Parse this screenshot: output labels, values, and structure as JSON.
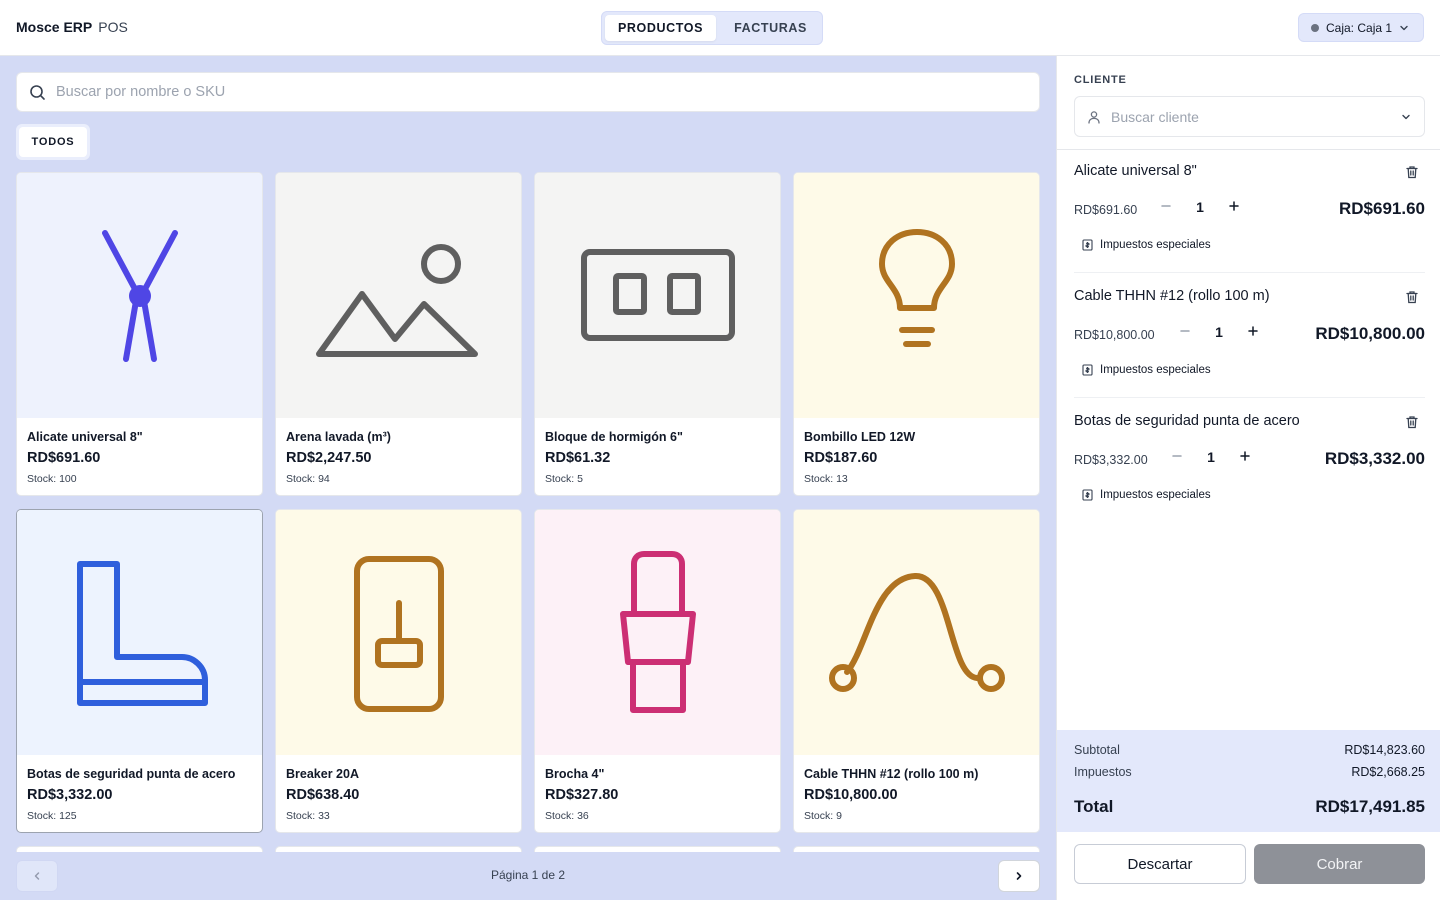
{
  "header": {
    "brand": "Mosce ERP",
    "module": "POS",
    "tabs": [
      {
        "label": "PRODUCTOS",
        "active": true
      },
      {
        "label": "FACTURAS",
        "active": false
      }
    ],
    "register": {
      "label": "Caja: Caja 1",
      "status_color": "#6b7280"
    }
  },
  "catalog": {
    "search": {
      "placeholder": "Buscar por nombre o SKU",
      "value": ""
    },
    "filter": {
      "label": "TODOS"
    },
    "products": [
      {
        "name": "Alicate universal 8\"",
        "price": "RD$691.60",
        "stock": "Stock: 100",
        "icon": "pliers-icon",
        "bg": "#eef2fd",
        "color": "#4f46e5"
      },
      {
        "name": "Arena lavada (m³)",
        "price": "RD$2,247.50",
        "stock": "Stock: 94",
        "icon": "image-placeholder-icon",
        "bg": "#f4f4f3",
        "color": "#5f5f5f"
      },
      {
        "name": "Bloque de hormigón 6\"",
        "price": "RD$61.32",
        "stock": "Stock: 5",
        "icon": "concrete-block-icon",
        "bg": "#f4f4f3",
        "color": "#5f5f5f"
      },
      {
        "name": "Bombillo LED 12W",
        "price": "RD$187.60",
        "stock": "Stock: 13",
        "icon": "light-bulb-icon",
        "bg": "#fefae8",
        "color": "#b07320"
      },
      {
        "name": "Botas de seguridad punta de acero",
        "price": "RD$3,332.00",
        "stock": "Stock: 125",
        "icon": "safety-boot-icon",
        "bg": "#edf3fe",
        "color": "#2f5fdc",
        "selected": true
      },
      {
        "name": "Breaker 20A",
        "price": "RD$638.40",
        "stock": "Stock: 33",
        "icon": "breaker-switch-icon",
        "bg": "#fefae8",
        "color": "#b07320"
      },
      {
        "name": "Brocha 4\"",
        "price": "RD$327.80",
        "stock": "Stock: 36",
        "icon": "paint-brush-icon",
        "bg": "#fdf1f7",
        "color": "#cc2f74"
      },
      {
        "name": "Cable THHN #12 (rollo 100 m)",
        "price": "RD$10,800.00",
        "stock": "Stock: 9",
        "icon": "cable-icon",
        "bg": "#fefae8",
        "color": "#b07320"
      }
    ],
    "pagination": {
      "text": "Página 1 de 2"
    }
  },
  "cart": {
    "cliente_label": "CLIENTE",
    "cliente_placeholder": "Buscar cliente",
    "items": [
      {
        "name": "Alicate universal 8\"",
        "unit_price": "RD$691.60",
        "qty": "1",
        "total": "RD$691.60",
        "tax_label": "Impuestos especiales"
      },
      {
        "name": "Cable THHN #12 (rollo 100 m)",
        "unit_price": "RD$10,800.00",
        "qty": "1",
        "total": "RD$10,800.00",
        "tax_label": "Impuestos especiales"
      },
      {
        "name": "Botas de seguridad punta de acero",
        "unit_price": "RD$3,332.00",
        "qty": "1",
        "total": "RD$3,332.00",
        "tax_label": "Impuestos especiales"
      }
    ],
    "summary": {
      "subtotal_label": "Subtotal",
      "subtotal": "RD$14,823.60",
      "tax_label": "Impuestos",
      "tax": "RD$2,668.25",
      "total_label": "Total",
      "total": "RD$17,491.85"
    },
    "discard_label": "Descartar",
    "charge_label": "Cobrar"
  },
  "colors": {
    "accent": "#d3daf5",
    "charge_button": "#8e9198"
  }
}
